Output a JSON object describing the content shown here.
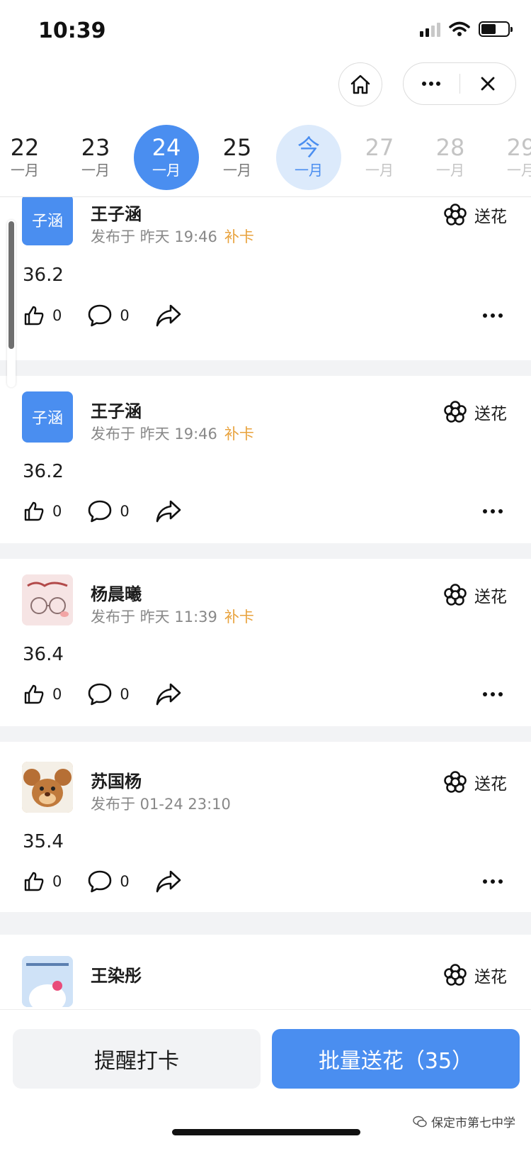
{
  "status_bar": {
    "time": "10:39"
  },
  "dates": [
    {
      "day": "22",
      "month": "一月",
      "state": "past"
    },
    {
      "day": "23",
      "month": "一月",
      "state": "past"
    },
    {
      "day": "24",
      "month": "一月",
      "state": "selected"
    },
    {
      "day": "25",
      "month": "一月",
      "state": "past"
    },
    {
      "day": "今",
      "month": "一月",
      "state": "today"
    },
    {
      "day": "27",
      "month": "一月",
      "state": "future"
    },
    {
      "day": "28",
      "month": "一月",
      "state": "future"
    },
    {
      "day": "29",
      "month": "一月",
      "state": "future"
    }
  ],
  "send_flower_label": "送花",
  "posts": [
    {
      "name": "王子涵",
      "avatar_text": "子涵",
      "avatar_type": "text",
      "meta": "发布于 昨天 19:46",
      "tag": "补卡",
      "value": "36.2",
      "likes": "0",
      "comments": "0"
    },
    {
      "name": "王子涵",
      "avatar_text": "子涵",
      "avatar_type": "text",
      "meta": "发布于 昨天 19:46",
      "tag": "补卡",
      "value": "36.2",
      "likes": "0",
      "comments": "0"
    },
    {
      "name": "杨晨曦",
      "avatar_text": "",
      "avatar_type": "sketch",
      "meta": "发布于 昨天 11:39",
      "tag": "补卡",
      "value": "36.4",
      "likes": "0",
      "comments": "0"
    },
    {
      "name": "苏国杨",
      "avatar_text": "",
      "avatar_type": "cartoon-mouse",
      "meta": "发布于 01-24 23:10",
      "tag": "",
      "value": "35.4",
      "likes": "0",
      "comments": "0"
    },
    {
      "name": "王染彤",
      "avatar_text": "",
      "avatar_type": "cartoon-cat",
      "meta": "",
      "tag": "",
      "value": "",
      "likes": "",
      "comments": ""
    }
  ],
  "bottom": {
    "remind_label": "提醒打卡",
    "batch_label": "批量送花（35）"
  },
  "watermark": "保定市第七中学",
  "colors": {
    "accent": "#4a8ef0",
    "today_bg": "#dceafb",
    "tag": "#e8a23c"
  }
}
